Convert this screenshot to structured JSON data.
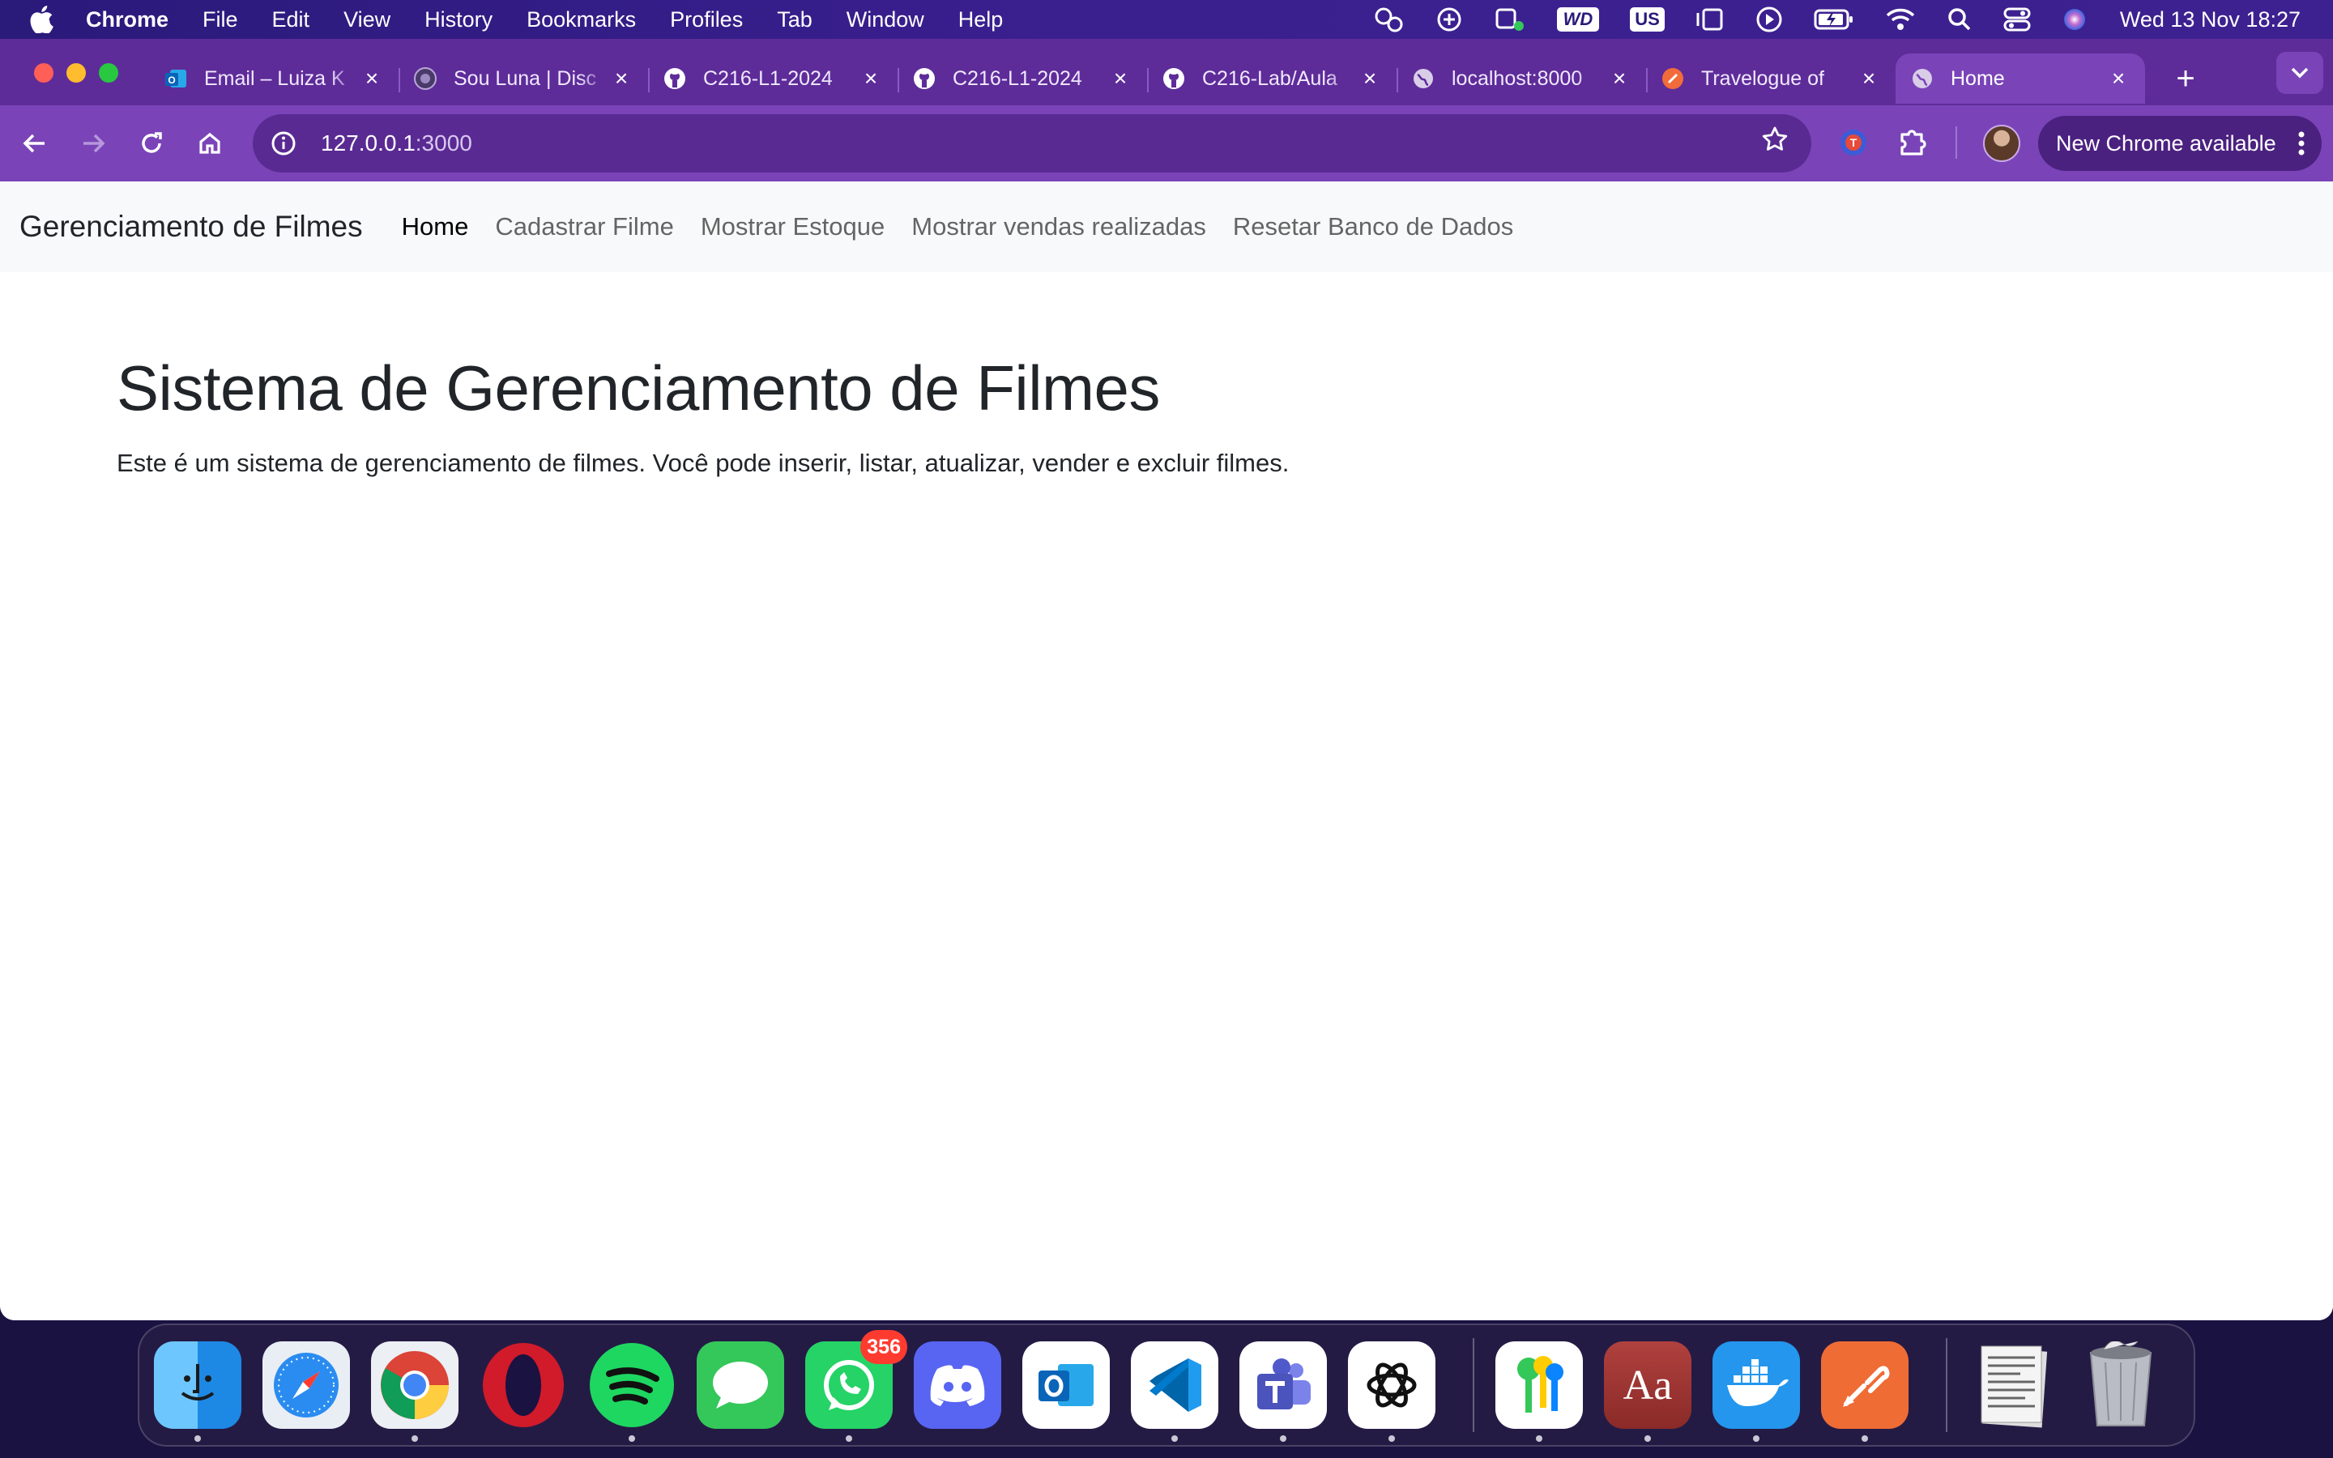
{
  "menubar": {
    "app_name": "Chrome",
    "items": [
      "File",
      "Edit",
      "View",
      "History",
      "Bookmarks",
      "Profiles",
      "Tab",
      "Window",
      "Help"
    ],
    "input_source": "US",
    "wd_label": "WD",
    "clock": "Wed 13 Nov  18:27"
  },
  "browser": {
    "tabs": [
      {
        "title": "Email – Luiza K",
        "favicon": "outlook-icon"
      },
      {
        "title": "Sou Luna | Disc",
        "favicon": "luna-icon"
      },
      {
        "title": "C216-L1-2024",
        "favicon": "github-icon"
      },
      {
        "title": "C216-L1-2024",
        "favicon": "github-icon"
      },
      {
        "title": "C216-Lab/Aula",
        "favicon": "github-icon"
      },
      {
        "title": "localhost:8000",
        "favicon": "globe-icon"
      },
      {
        "title": "Travelogue of",
        "favicon": "travelogue-icon"
      },
      {
        "title": "Home",
        "favicon": "globe-icon",
        "active": true
      }
    ],
    "url_host": "127.0.0.1",
    "url_port": ":3000",
    "update_label": "New Chrome available",
    "colors": {
      "tabstrip": "#5e2c99",
      "toolbar": "#7a44b8"
    }
  },
  "page": {
    "brand": "Gerenciamento de Filmes",
    "nav": [
      "Home",
      "Cadastrar Filme",
      "Mostrar Estoque",
      "Mostrar vendas realizadas",
      "Resetar Banco de Dados"
    ],
    "heading": "Sistema de Gerenciamento de Filmes",
    "description": "Este é um sistema de gerenciamento de filmes. Você pode inserir, listar, atualizar, vender e excluir filmes."
  },
  "dock": {
    "whatsapp_badge": "356",
    "dictionary_label": "Aa",
    "apps": [
      "Finder",
      "Safari",
      "Chrome",
      "Opera",
      "Spotify",
      "Messages",
      "WhatsApp",
      "Discord",
      "Outlook",
      "VS Code",
      "Teams",
      "ChatGPT",
      "Passwords",
      "Dictionary",
      "Docker",
      "Postman",
      "Document",
      "Trash"
    ]
  }
}
